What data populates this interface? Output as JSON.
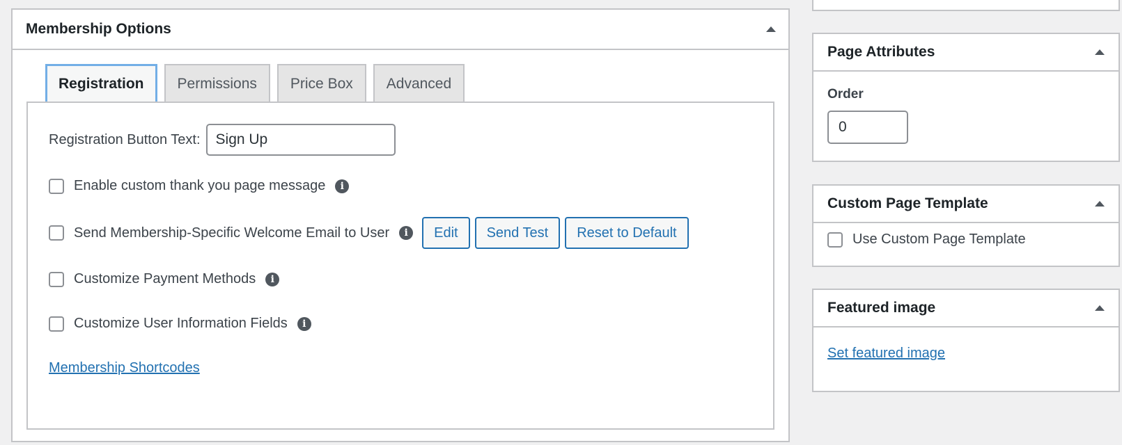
{
  "membership_options": {
    "title": "Membership Options",
    "tabs": [
      {
        "label": "Registration",
        "active": true
      },
      {
        "label": "Permissions",
        "active": false
      },
      {
        "label": "Price Box",
        "active": false
      },
      {
        "label": "Advanced",
        "active": false
      }
    ],
    "registration": {
      "button_text_label": "Registration Button Text:",
      "button_text_value": "Sign Up",
      "options": [
        {
          "label": "Enable custom thank you page message",
          "checked": false
        },
        {
          "label": "Send Membership-Specific Welcome Email to User",
          "checked": false
        },
        {
          "label": "Customize Payment Methods",
          "checked": false
        },
        {
          "label": "Customize User Information Fields",
          "checked": false
        }
      ],
      "email_buttons": {
        "edit": "Edit",
        "send_test": "Send Test",
        "reset": "Reset to Default"
      },
      "shortcodes_link": "Membership Shortcodes"
    }
  },
  "page_attributes": {
    "title": "Page Attributes",
    "order_label": "Order",
    "order_value": "0"
  },
  "custom_page_template": {
    "title": "Custom Page Template",
    "checkbox_label": "Use Custom Page Template",
    "checked": false
  },
  "featured_image": {
    "title": "Featured image",
    "link": "Set featured image"
  },
  "colors": {
    "link": "#2271b1",
    "border": "#c3c4c7",
    "background": "#f0f0f1",
    "active_tab_border": "#72aee6"
  },
  "icons": [
    "toggle-arrow-icon",
    "info-icon"
  ]
}
